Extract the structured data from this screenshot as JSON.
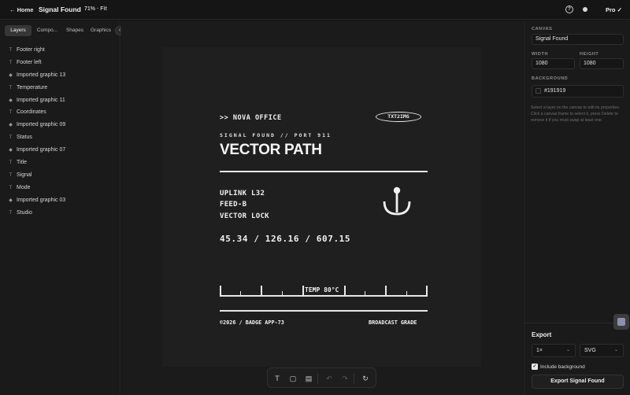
{
  "topbar": {
    "home_label": "← Home",
    "doc_title": "Signal Found",
    "zoom_label": "71% · Fit",
    "help_glyph": "?",
    "plan_label": "Pro ✓"
  },
  "left_panel": {
    "tabs": [
      {
        "label": "Layers",
        "active": true
      },
      {
        "label": "Compo...",
        "active": false
      },
      {
        "label": "Shapes",
        "active": false
      },
      {
        "label": "Graphics",
        "active": false
      }
    ],
    "collapse_glyph": "‹",
    "layers": [
      {
        "icon": "text-icon",
        "glyph": "T",
        "name": "Footer right"
      },
      {
        "icon": "text-icon",
        "glyph": "T",
        "name": "Footer left"
      },
      {
        "icon": "graphic-icon",
        "glyph": "◆",
        "name": "Imported graphic 13"
      },
      {
        "icon": "text-icon",
        "glyph": "T",
        "name": "Temperature"
      },
      {
        "icon": "graphic-icon",
        "glyph": "◆",
        "name": "Imported graphic 11"
      },
      {
        "icon": "text-icon",
        "glyph": "T",
        "name": "Coordinates"
      },
      {
        "icon": "graphic-icon",
        "glyph": "◆",
        "name": "Imported graphic 09"
      },
      {
        "icon": "text-icon",
        "glyph": "T",
        "name": "Status"
      },
      {
        "icon": "graphic-icon",
        "glyph": "◆",
        "name": "Imported graphic 07"
      },
      {
        "icon": "text-icon",
        "glyph": "T",
        "name": "Title"
      },
      {
        "icon": "text-icon",
        "glyph": "T",
        "name": "Signal"
      },
      {
        "icon": "text-icon",
        "glyph": "T",
        "name": "Mode"
      },
      {
        "icon": "graphic-icon",
        "glyph": "◆",
        "name": "Imported graphic 03"
      },
      {
        "icon": "text-icon",
        "glyph": "T",
        "name": "Studio"
      }
    ]
  },
  "artboard": {
    "office": ">> NOVA OFFICE",
    "badge": "TXT2IMG",
    "subtitle": "SIGNAL FOUND // PORT 911",
    "headline": "VECTOR PATH",
    "status_lines": [
      "UPLINK L32",
      "FEED-B",
      "VECTOR LOCK"
    ],
    "coordinates": "45.34 / 126.16 / 607.15",
    "temperature": "TEMP 80°C",
    "footer_left": "©2026 / BADGE APP-73",
    "footer_right": "BROADCAST GRADE",
    "background": "#1f1f1f",
    "ink": "#f0f0f0"
  },
  "toolbar": {
    "tools": [
      {
        "icon": "text-tool-icon",
        "glyph": "T",
        "enabled": true
      },
      {
        "icon": "rectangle-tool-icon",
        "glyph": "▢",
        "enabled": true
      },
      {
        "icon": "layout-tool-icon",
        "glyph": "▤",
        "enabled": true
      },
      {
        "icon": "undo-icon",
        "glyph": "↶",
        "enabled": false
      },
      {
        "icon": "redo-icon",
        "glyph": "↷",
        "enabled": false
      },
      {
        "icon": "reset-icon",
        "glyph": "↻",
        "enabled": true
      }
    ]
  },
  "right_panel": {
    "canvas_label": "CANVAS",
    "canvas_name": "Signal Found",
    "width_label": "WIDTH",
    "width_value": "1080",
    "height_label": "HEIGHT",
    "height_value": "1080",
    "background_label": "BACKGROUND",
    "background_value": "#191919",
    "hint": "Select a layer on the canvas to edit its properties. Click a canvas frame to select it, press Delete to remove it if you must swap at least one.",
    "export": {
      "title": "Export",
      "scale": "1×",
      "format": "SVG",
      "include_background_label": "Include background",
      "include_background": true,
      "button_label": "Export Signal Found"
    }
  }
}
